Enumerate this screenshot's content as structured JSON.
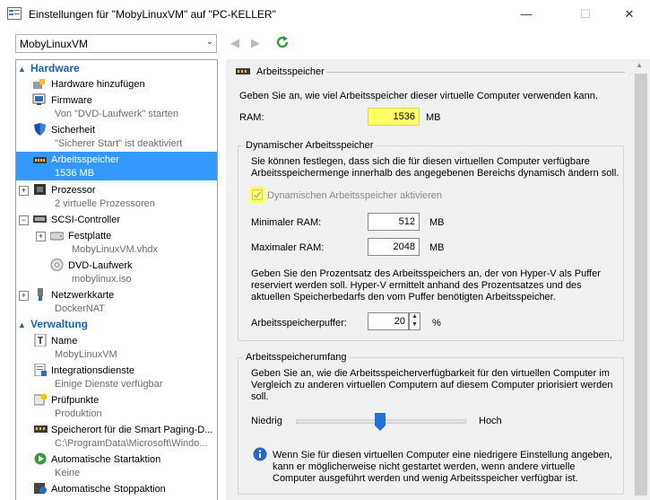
{
  "window": {
    "title": "Einstellungen für \"MobyLinuxVM\" auf \"PC-KELLER\"",
    "minimize": "—",
    "maximize": "☐",
    "close": "✕"
  },
  "toolbar": {
    "vm_selected": "MobyLinuxVM",
    "back": "◀",
    "forward": "▶"
  },
  "tree": {
    "hardware_header": "Hardware",
    "management_header": "Verwaltung",
    "items": [
      {
        "label": "Hardware hinzufügen",
        "sub": ""
      },
      {
        "label": "Firmware",
        "sub": "Von \"DVD-Laufwerk\" starten"
      },
      {
        "label": "Sicherheit",
        "sub": "\"Sicherer Start\" ist deaktiviert"
      },
      {
        "label": "Arbeitsspeicher",
        "sub": "1536 MB"
      },
      {
        "label": "Prozessor",
        "sub": "2 virtuelle Prozessoren"
      },
      {
        "label": "SCSI-Controller",
        "sub": ""
      },
      {
        "label": "Festplatte",
        "sub": "MobyLinuxVM.vhdx"
      },
      {
        "label": "DVD-Laufwerk",
        "sub": "mobylinux.iso"
      },
      {
        "label": "Netzwerkkarte",
        "sub": "DockerNAT"
      },
      {
        "label": "Name",
        "sub": "MobyLinuxVM"
      },
      {
        "label": "Integrationsdienste",
        "sub": "Einige Dienste verfügbar"
      },
      {
        "label": "Prüfpunkte",
        "sub": "Produktion"
      },
      {
        "label": "Speicherort für die Smart Paging-D...",
        "sub": "C:\\ProgramData\\Microsoft\\Windo..."
      },
      {
        "label": "Automatische Startaktion",
        "sub": "Keine"
      },
      {
        "label": "Automatische Stoppaktion",
        "sub": ""
      }
    ]
  },
  "memory": {
    "section_title": "Arbeitsspeicher",
    "intro": "Geben Sie an, wie viel Arbeitsspeicher dieser virtuelle Computer verwenden kann.",
    "ram_label": "RAM:",
    "ram_value": "1536",
    "unit": "MB",
    "dynamic_group": "Dynamischer Arbeitsspeicher",
    "dynamic_desc1": "Sie können festlegen, dass sich die für diesen virtuellen Computer verfügbare",
    "dynamic_desc2": "Arbeitsspeichermenge innerhalb des angegebenen Bereichs dynamisch ändern soll.",
    "dynamic_checkbox": "Dynamischen Arbeitsspeicher aktivieren",
    "min_label": "Minimaler RAM:",
    "min_value": "512",
    "max_label": "Maximaler RAM:",
    "max_value": "2048",
    "buffer_desc1": "Geben Sie den Prozentsatz des Arbeitsspeichers an, der von Hyper-V als Puffer",
    "buffer_desc2": "reserviert werden soll. Hyper-V ermittelt anhand des Prozentsatzes und des",
    "buffer_desc3": "aktuellen Speicherbedarfs den vom Puffer benötigten Arbeitsspeicher.",
    "buffer_label": "Arbeitsspeicherpuffer:",
    "buffer_value": "20",
    "percent": "%",
    "weight_group": "Arbeitsspeicherumfang",
    "weight_desc1": "Geben Sie an, wie die Arbeitsspeicherverfügbarkeit für den virtuellen Computer im",
    "weight_desc2": "Vergleich zu anderen virtuellen Computern auf diesem Computer priorisiert werden",
    "weight_desc3": "soll.",
    "low": "Niedrig",
    "high": "Hoch",
    "slider_level": 0.5,
    "info1": "Wenn Sie für diesen virtuellen Computer eine niedrigere Einstellung angeben,",
    "info2": "kann er möglicherweise nicht gestartet werden, wenn andere virtuelle",
    "info3": "Computer ausgeführt werden und wenig Arbeitsspeicher verfügbar ist."
  },
  "colors": {
    "accent": "#3399ff",
    "section_header": "#1c5fb8",
    "highlight": "#ffff66"
  }
}
